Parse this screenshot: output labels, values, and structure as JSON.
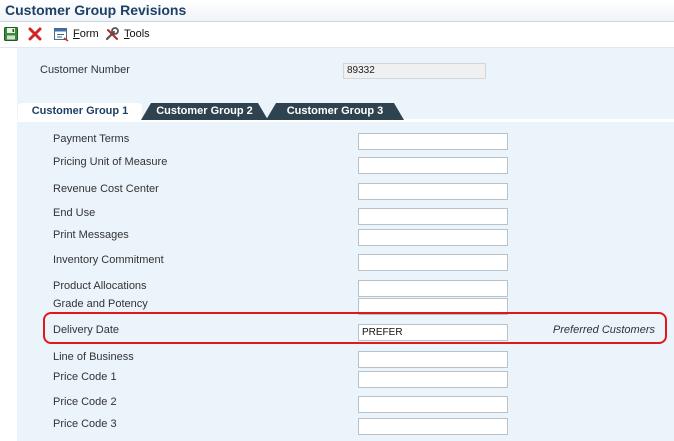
{
  "window": {
    "title": "Customer Group Revisions"
  },
  "toolbar": {
    "form_label": "Form",
    "form_underline": "F",
    "form_rest": "orm",
    "tools_underline": "T",
    "tools_rest": "ools",
    "tools_label": "Tools"
  },
  "header": {
    "customer_number_label": "Customer Number",
    "customer_number_value": "89332"
  },
  "tabs": [
    {
      "label": "Customer Group 1",
      "active": true
    },
    {
      "label": "Customer Group 2",
      "active": false
    },
    {
      "label": "Customer Group 3",
      "active": false
    }
  ],
  "fields": [
    {
      "label": "Payment Terms",
      "value": ""
    },
    {
      "label": "Pricing Unit of Measure",
      "value": ""
    },
    {
      "label": "Revenue Cost Center",
      "value": ""
    },
    {
      "label": "End Use",
      "value": ""
    },
    {
      "label": "Print Messages",
      "value": ""
    },
    {
      "label": "Inventory Commitment",
      "value": ""
    },
    {
      "label": "Product Allocations",
      "value": ""
    },
    {
      "label": "Grade and Potency",
      "value": ""
    },
    {
      "label": "Delivery Date",
      "value": "PREFER",
      "description": "Preferred Customers",
      "highlighted": true
    },
    {
      "label": "Line of Business",
      "value": ""
    },
    {
      "label": "Price Code 1",
      "value": ""
    },
    {
      "label": "Price Code 2",
      "value": ""
    },
    {
      "label": "Price Code 3",
      "value": ""
    }
  ],
  "colors": {
    "title": "#1e3f66",
    "form_background": "#ebf3fb",
    "tab_inactive": "#2f4250",
    "highlight": "#e01818"
  }
}
